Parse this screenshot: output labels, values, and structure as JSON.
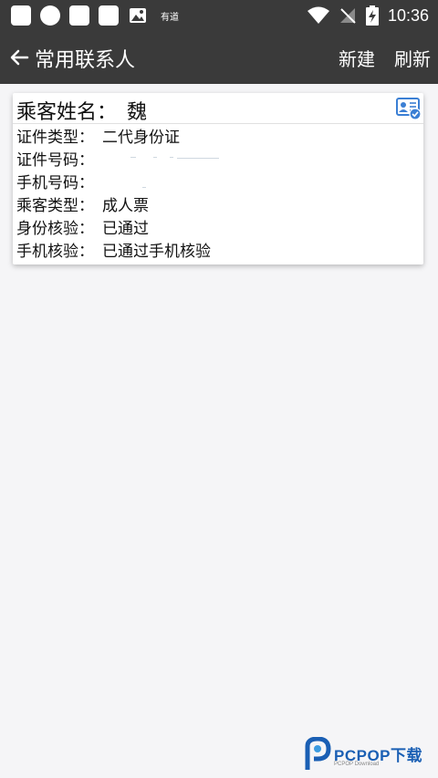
{
  "status_bar": {
    "note_label": "有道",
    "time": "10:36"
  },
  "app_bar": {
    "title": "常用联系人",
    "new_label": "新建",
    "refresh_label": "刷新"
  },
  "passenger": {
    "name_label": "乘客姓名：",
    "name_value": "魏",
    "rows": [
      {
        "label": "证件类型：",
        "value": "二代身份证"
      },
      {
        "label": "证件号码：",
        "value": ""
      },
      {
        "label": "手机号码：",
        "value": ""
      },
      {
        "label": "乘客类型：",
        "value": "成人票"
      },
      {
        "label": "身份核验：",
        "value": "已通过"
      },
      {
        "label": "手机核验：",
        "value": "已通过手机核验"
      }
    ]
  },
  "watermark": {
    "brand": "PCPOP下载",
    "sub": "PCPOP Download"
  },
  "colors": {
    "bar_bg": "#3a3a3a",
    "page_bg": "#f5f5f7",
    "accent": "#1a5fb4"
  }
}
